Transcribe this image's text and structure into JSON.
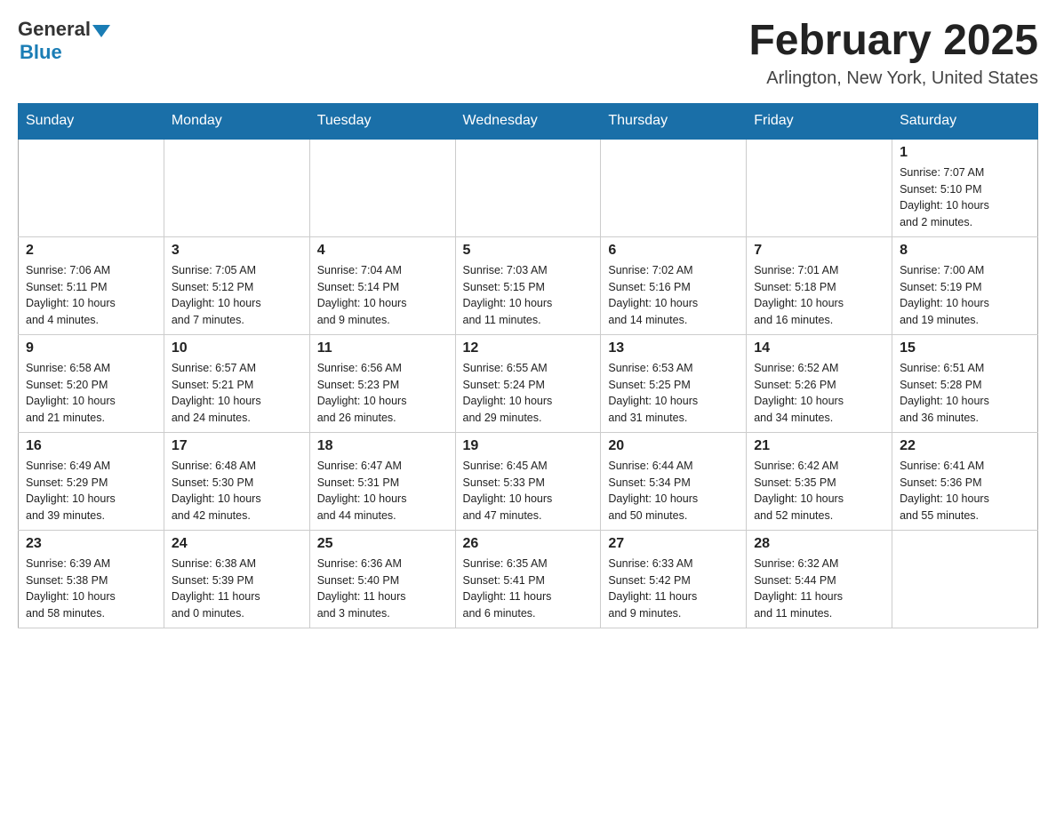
{
  "header": {
    "logo_general": "General",
    "logo_blue": "Blue",
    "month_title": "February 2025",
    "location": "Arlington, New York, United States"
  },
  "weekdays": [
    "Sunday",
    "Monday",
    "Tuesday",
    "Wednesday",
    "Thursday",
    "Friday",
    "Saturday"
  ],
  "weeks": [
    [
      {
        "day": "",
        "info": ""
      },
      {
        "day": "",
        "info": ""
      },
      {
        "day": "",
        "info": ""
      },
      {
        "day": "",
        "info": ""
      },
      {
        "day": "",
        "info": ""
      },
      {
        "day": "",
        "info": ""
      },
      {
        "day": "1",
        "info": "Sunrise: 7:07 AM\nSunset: 5:10 PM\nDaylight: 10 hours\nand 2 minutes."
      }
    ],
    [
      {
        "day": "2",
        "info": "Sunrise: 7:06 AM\nSunset: 5:11 PM\nDaylight: 10 hours\nand 4 minutes."
      },
      {
        "day": "3",
        "info": "Sunrise: 7:05 AM\nSunset: 5:12 PM\nDaylight: 10 hours\nand 7 minutes."
      },
      {
        "day": "4",
        "info": "Sunrise: 7:04 AM\nSunset: 5:14 PM\nDaylight: 10 hours\nand 9 minutes."
      },
      {
        "day": "5",
        "info": "Sunrise: 7:03 AM\nSunset: 5:15 PM\nDaylight: 10 hours\nand 11 minutes."
      },
      {
        "day": "6",
        "info": "Sunrise: 7:02 AM\nSunset: 5:16 PM\nDaylight: 10 hours\nand 14 minutes."
      },
      {
        "day": "7",
        "info": "Sunrise: 7:01 AM\nSunset: 5:18 PM\nDaylight: 10 hours\nand 16 minutes."
      },
      {
        "day": "8",
        "info": "Sunrise: 7:00 AM\nSunset: 5:19 PM\nDaylight: 10 hours\nand 19 minutes."
      }
    ],
    [
      {
        "day": "9",
        "info": "Sunrise: 6:58 AM\nSunset: 5:20 PM\nDaylight: 10 hours\nand 21 minutes."
      },
      {
        "day": "10",
        "info": "Sunrise: 6:57 AM\nSunset: 5:21 PM\nDaylight: 10 hours\nand 24 minutes."
      },
      {
        "day": "11",
        "info": "Sunrise: 6:56 AM\nSunset: 5:23 PM\nDaylight: 10 hours\nand 26 minutes."
      },
      {
        "day": "12",
        "info": "Sunrise: 6:55 AM\nSunset: 5:24 PM\nDaylight: 10 hours\nand 29 minutes."
      },
      {
        "day": "13",
        "info": "Sunrise: 6:53 AM\nSunset: 5:25 PM\nDaylight: 10 hours\nand 31 minutes."
      },
      {
        "day": "14",
        "info": "Sunrise: 6:52 AM\nSunset: 5:26 PM\nDaylight: 10 hours\nand 34 minutes."
      },
      {
        "day": "15",
        "info": "Sunrise: 6:51 AM\nSunset: 5:28 PM\nDaylight: 10 hours\nand 36 minutes."
      }
    ],
    [
      {
        "day": "16",
        "info": "Sunrise: 6:49 AM\nSunset: 5:29 PM\nDaylight: 10 hours\nand 39 minutes."
      },
      {
        "day": "17",
        "info": "Sunrise: 6:48 AM\nSunset: 5:30 PM\nDaylight: 10 hours\nand 42 minutes."
      },
      {
        "day": "18",
        "info": "Sunrise: 6:47 AM\nSunset: 5:31 PM\nDaylight: 10 hours\nand 44 minutes."
      },
      {
        "day": "19",
        "info": "Sunrise: 6:45 AM\nSunset: 5:33 PM\nDaylight: 10 hours\nand 47 minutes."
      },
      {
        "day": "20",
        "info": "Sunrise: 6:44 AM\nSunset: 5:34 PM\nDaylight: 10 hours\nand 50 minutes."
      },
      {
        "day": "21",
        "info": "Sunrise: 6:42 AM\nSunset: 5:35 PM\nDaylight: 10 hours\nand 52 minutes."
      },
      {
        "day": "22",
        "info": "Sunrise: 6:41 AM\nSunset: 5:36 PM\nDaylight: 10 hours\nand 55 minutes."
      }
    ],
    [
      {
        "day": "23",
        "info": "Sunrise: 6:39 AM\nSunset: 5:38 PM\nDaylight: 10 hours\nand 58 minutes."
      },
      {
        "day": "24",
        "info": "Sunrise: 6:38 AM\nSunset: 5:39 PM\nDaylight: 11 hours\nand 0 minutes."
      },
      {
        "day": "25",
        "info": "Sunrise: 6:36 AM\nSunset: 5:40 PM\nDaylight: 11 hours\nand 3 minutes."
      },
      {
        "day": "26",
        "info": "Sunrise: 6:35 AM\nSunset: 5:41 PM\nDaylight: 11 hours\nand 6 minutes."
      },
      {
        "day": "27",
        "info": "Sunrise: 6:33 AM\nSunset: 5:42 PM\nDaylight: 11 hours\nand 9 minutes."
      },
      {
        "day": "28",
        "info": "Sunrise: 6:32 AM\nSunset: 5:44 PM\nDaylight: 11 hours\nand 11 minutes."
      },
      {
        "day": "",
        "info": ""
      }
    ]
  ]
}
